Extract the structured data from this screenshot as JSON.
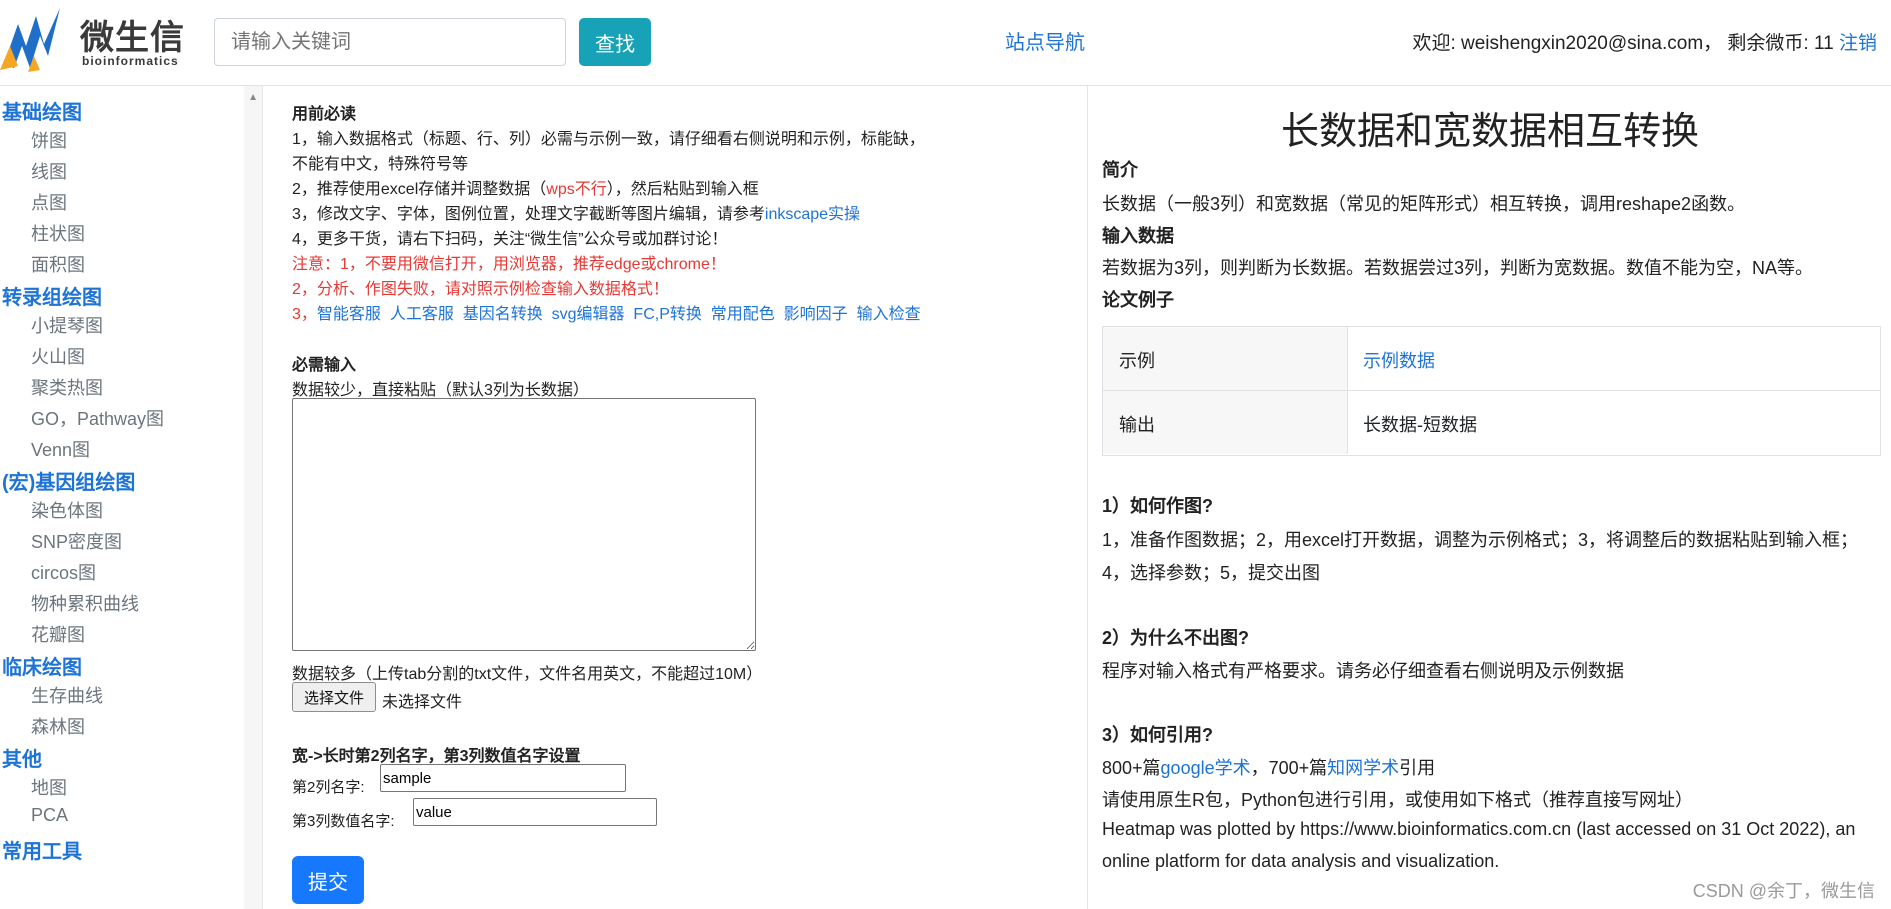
{
  "header": {
    "logo_cn": "微生信",
    "logo_en": "bioinformatics",
    "search_placeholder": "请输入关键词",
    "search_button": "查找",
    "site_nav": "站点导航",
    "welcome_prefix": "欢迎: weishengxin2020@sina.com， 剩余微币: 11 ",
    "logout": "注销"
  },
  "sidebar": {
    "categories": [
      {
        "label": "基础绘图",
        "items": [
          "饼图",
          "线图",
          "点图",
          "柱状图",
          "面积图"
        ]
      },
      {
        "label": "转录组绘图",
        "items": [
          "小提琴图",
          "火山图",
          "聚类热图",
          "GO，Pathway图",
          "Venn图"
        ]
      },
      {
        "label": "(宏)基因组绘图",
        "items": [
          "染色体图",
          "SNP密度图",
          "circos图",
          "物种累积曲线",
          "花瓣图"
        ]
      },
      {
        "label": "临床绘图",
        "items": [
          "生存曲线",
          "森林图"
        ]
      },
      {
        "label": "其他",
        "items": [
          "地图",
          "PCA"
        ]
      },
      {
        "label": "常用工具",
        "items": []
      }
    ]
  },
  "notice": {
    "title": "用前必读",
    "l1a": "1，输入数据格式（标题、行、列）必需与示例一致，请仔细看右侧说明和示例，标能缺，",
    "l1b": "不能有中文，特殊符号等",
    "l2_pre": "2，推荐使用excel存储并调整数据（",
    "l2_red": "wps不行",
    "l2_post": "），然后粘贴到输入框",
    "l3_pre": "3，修改文字、字体，图例位置，处理文字截断等图片编辑，请参考",
    "l3_link": "inkscape实操",
    "l4": "4，更多干货，请右下扫码，关注“微生信”公众号或加群讨论！",
    "warn1": "注意：1，不要用微信打开，用浏览器，推荐edge或chrome！",
    "warn2": "2，分析、作图失败，请对照示例检查输入数据格式！",
    "links_prefix": "3，",
    "links": [
      "智能客服",
      "人工客服",
      "基因名转换",
      "svg编辑器",
      "FC,P转换",
      "常用配色",
      "影响因子",
      "输入检查"
    ]
  },
  "form": {
    "required_title": "必需输入",
    "paste_hint": "数据较少，直接粘贴（默认3列为长数据）",
    "upload_hint": "数据较多（上传tab分割的txt文件，文件名用英文，不能超过10M）",
    "file_button": "选择文件",
    "no_file": "未选择文件",
    "name_settings_title": "宽->长时第2列名字，第3列数值名字设置",
    "col2_label": "第2列名字:",
    "col2_value": "sample",
    "col3_label": "第3列数值名字:",
    "col3_value": "value",
    "submit": "提交"
  },
  "right": {
    "title": "长数据和宽数据相互转换",
    "intro_head": "简介",
    "intro_text": "长数据（一般3列）和宽数据（常见的矩阵形式）相互转换，调用reshape2函数。",
    "input_head": "输入数据",
    "input_text": "若数据为3列，则判断为长数据。若数据尝过3列，判断为宽数据。数值不能为空，NA等。",
    "paper_head": "论文例子",
    "table": [
      {
        "key": "示例",
        "value": "示例数据"
      },
      {
        "key": "输出",
        "value": "长数据-短数据"
      }
    ],
    "q1_head": "1）如何作图?",
    "q1_l1": "1，准备作图数据；2，用excel打开数据，调整为示例格式；3，将调整后的数据粘贴到输入框；",
    "q1_l2": "4，选择参数；5，提交出图",
    "q2_head": "2）为什么不出图?",
    "q2_text": "程序对输入格式有严格要求。请务必仔细查看右侧说明及示例数据",
    "q3_head": "3）如何引用?",
    "q3_pre": "800+篇",
    "q3_link1": "google学术",
    "q3_mid": "，700+篇",
    "q3_link2": "知网学术",
    "q3_post": "引用",
    "q3_l2": "请使用原生R包，Python包进行引用，或使用如下格式（推荐直接写网址）",
    "q3_l3": "Heatmap was plotted by https://www.bioinformatics.com.cn (last accessed on 31 Oct 2022), an",
    "q3_l4": "online platform for data analysis and visualization."
  },
  "watermark": "CSDN @余丁，微生信"
}
